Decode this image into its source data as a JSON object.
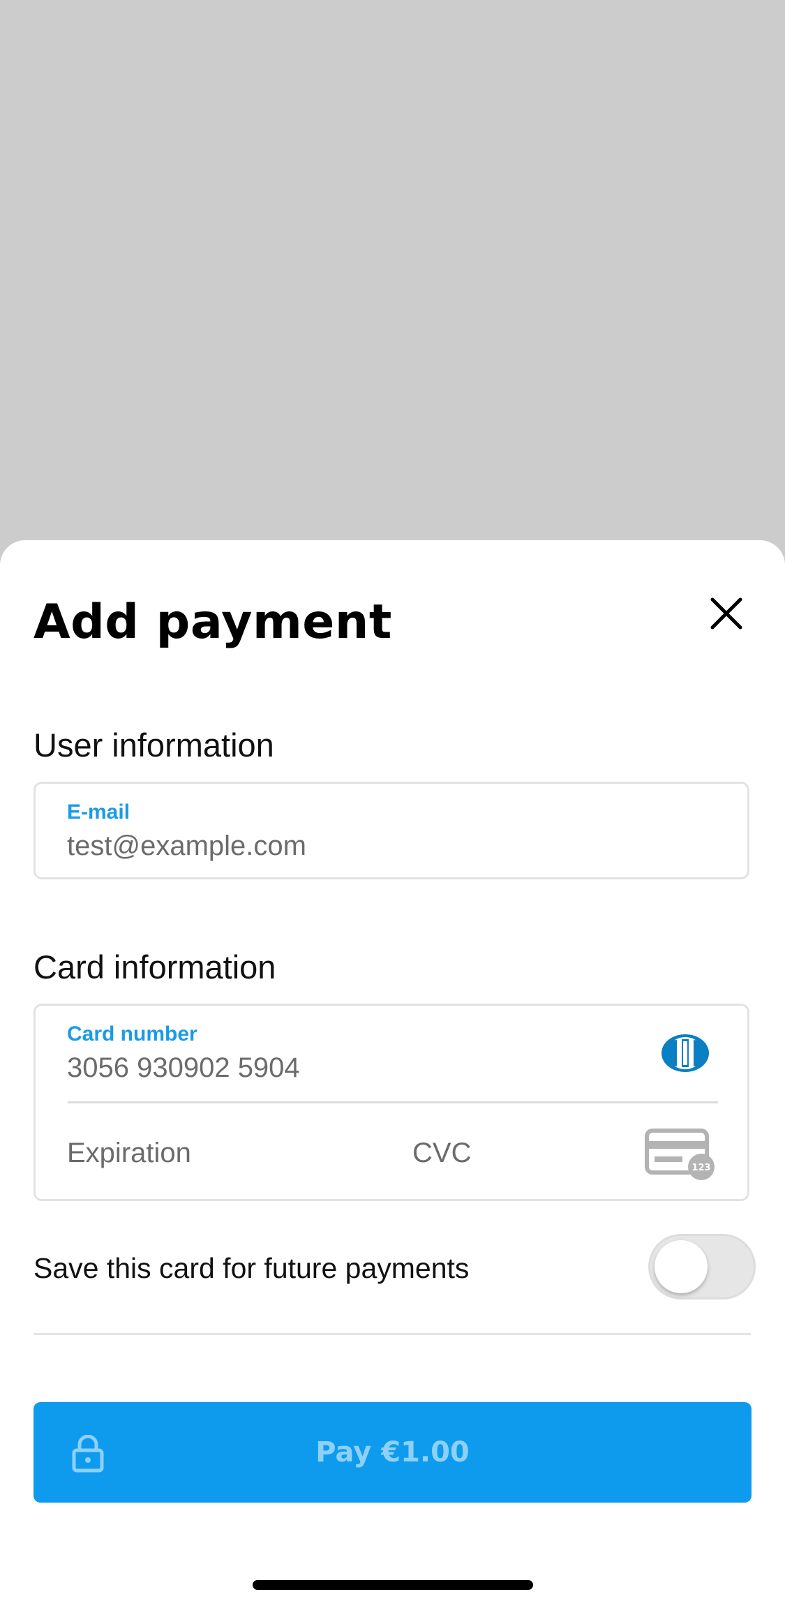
{
  "sheet": {
    "title": "Add payment",
    "close_icon": "close-icon"
  },
  "user_info": {
    "heading": "User information",
    "email": {
      "label": "E-mail",
      "value": "test@example.com"
    }
  },
  "card_info": {
    "heading": "Card information",
    "card_number": {
      "label": "Card number",
      "value": "3056 930902 5904",
      "brand_icon": "diners-club-icon"
    },
    "expiration_placeholder": "Expiration",
    "cvc_placeholder": "CVC",
    "cvc_icon": "cvc-card-icon",
    "cvc_badge": "123"
  },
  "save_card": {
    "label": "Save this card for future payments",
    "enabled": false
  },
  "pay_button": {
    "label": "Pay €1.00",
    "icon": "lock-icon"
  },
  "colors": {
    "accent": "#0e9bed",
    "label_blue": "#1a9be6",
    "backdrop": "#cccccc"
  }
}
